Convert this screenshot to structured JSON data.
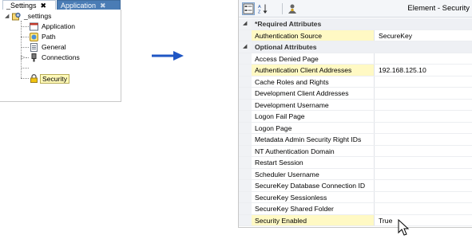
{
  "left_panel": {
    "tabs": [
      {
        "label": "_Settings",
        "active": true
      },
      {
        "label": "Application",
        "active": false
      }
    ],
    "close_glyph": "✖",
    "tree": {
      "root": {
        "label": "_settings",
        "icon": "settings-folder-icon"
      },
      "children": [
        {
          "label": "Application",
          "icon": "application-window-icon"
        },
        {
          "label": "Path",
          "icon": "path-icon"
        },
        {
          "label": "General",
          "icon": "document-icon"
        },
        {
          "label": "Connections",
          "icon": "connections-icon"
        },
        {
          "label": "Security",
          "icon": "lock-icon",
          "selected": true
        }
      ]
    }
  },
  "property_grid": {
    "title": "Element - Security",
    "toolbar": {
      "buttons": [
        {
          "icon": "categorized-view-icon",
          "active": true
        },
        {
          "icon": "sort-alphabetical-icon",
          "active": false
        },
        {
          "icon": "property-pages-icon",
          "active": false
        }
      ]
    },
    "rows": [
      {
        "type": "category",
        "name": "*Required Attributes"
      },
      {
        "type": "property",
        "name": "Authentication Source",
        "value": "SecureKey",
        "highlighted": true
      },
      {
        "type": "category",
        "name": "Optional Attributes"
      },
      {
        "type": "property",
        "name": "Access Denied Page",
        "value": ""
      },
      {
        "type": "property",
        "name": "Authentication Client Addresses",
        "value": "192.168.125.10",
        "highlighted": true
      },
      {
        "type": "property",
        "name": "Cache Roles and Rights",
        "value": ""
      },
      {
        "type": "property",
        "name": "Development Client Addresses",
        "value": ""
      },
      {
        "type": "property",
        "name": "Development Username",
        "value": ""
      },
      {
        "type": "property",
        "name": "Logon Fail Page",
        "value": ""
      },
      {
        "type": "property",
        "name": "Logon Page",
        "value": ""
      },
      {
        "type": "property",
        "name": "Metadata Admin Security Right IDs",
        "value": ""
      },
      {
        "type": "property",
        "name": "NT Authentication Domain",
        "value": ""
      },
      {
        "type": "property",
        "name": "Restart Session",
        "value": ""
      },
      {
        "type": "property",
        "name": "Scheduler Username",
        "value": ""
      },
      {
        "type": "property",
        "name": "SecureKey Database Connection ID",
        "value": ""
      },
      {
        "type": "property",
        "name": "SecureKey Sessionless",
        "value": ""
      },
      {
        "type": "property",
        "name": "SecureKey Shared Folder",
        "value": ""
      },
      {
        "type": "property",
        "name": "Security Enabled",
        "value": "True",
        "highlighted": true
      }
    ]
  },
  "colors": {
    "active_tab": "#4a7cb5",
    "highlight": "#fff9c4",
    "arrow": "#1f56c4"
  }
}
